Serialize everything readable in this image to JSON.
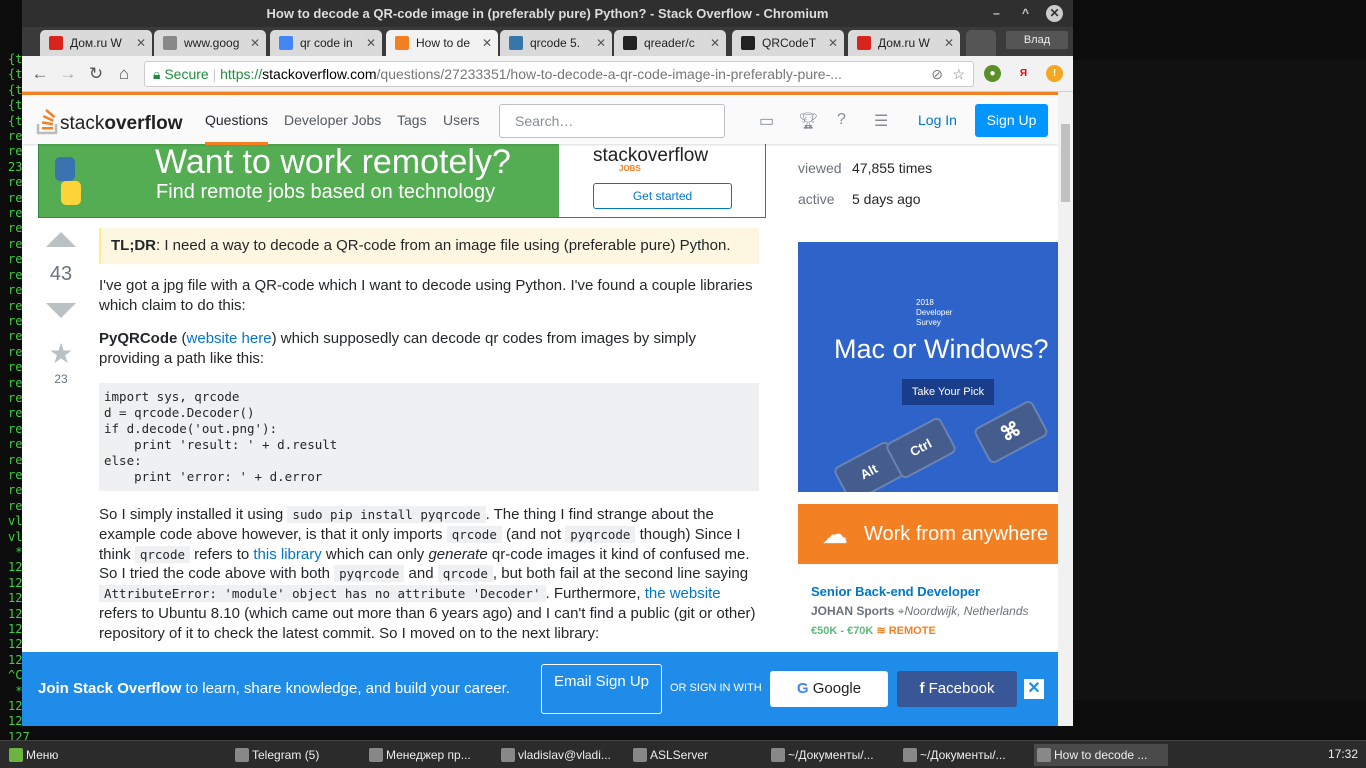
{
  "window": {
    "title": "How to decode a QR-code image in (preferably pure) Python? - Stack Overflow - Chromium"
  },
  "tabs": [
    {
      "label": "Дом.ru W",
      "color": "#d9241e"
    },
    {
      "label": "www.goog",
      "color": "#888888"
    },
    {
      "label": "qr code in",
      "color": "#4285f4"
    },
    {
      "label": "How to de",
      "color": "#f48024"
    },
    {
      "label": "qrcode 5.",
      "color": "#3776ab"
    },
    {
      "label": "qreader/c",
      "color": "#222222"
    },
    {
      "label": "QRCodeT",
      "color": "#222222"
    },
    {
      "label": "Дом.ru W",
      "color": "#d9241e"
    }
  ],
  "profile": "Влад",
  "omnibox": {
    "secure": "Secure",
    "scheme": "https://",
    "host": "stackoverflow.com",
    "path": "/questions/27233351/how-to-decode-a-qr-code-image-in-preferably-pure-..."
  },
  "so": {
    "logo_a": "stack",
    "logo_b": "overflow",
    "nav": [
      "Questions",
      "Developer Jobs",
      "Tags",
      "Users"
    ],
    "search_placeholder": "Search…",
    "login": "Log In",
    "signup": "Sign Up"
  },
  "banner": {
    "headline": "Want to work remotely?",
    "sub": "Find remote jobs based on technology",
    "brand": "stackoverflow",
    "brand_sub": "JOBS",
    "cta": "Get started"
  },
  "question": {
    "votes": "43",
    "favorites": "23",
    "tldr_label": "TL;DR",
    "tldr": ": I need a way to decode a QR-code from an image file using (preferable pure) Python.",
    "p1": "I've got a jpg file with a QR-code which I want to decode using Python. I've found a couple libraries which claim to do this:",
    "p2_b": "PyQRCode",
    "p2_link": "website here",
    "p2_rest": ") which supposedly can decode qr codes from images by simply providing a path like this:",
    "code": "import sys, qrcode\nd = qrcode.Decoder()\nif d.decode('out.png'):\n    print 'result: ' + d.result\nelse:\n    print 'error: ' + d.error",
    "p3": {
      "a": "So I simply installed it using ",
      "c1": "sudo pip install pyqrcode",
      "b": ". The thing I find strange about the example code above however, is that it only imports ",
      "c2": "qrcode",
      "c": " (and not ",
      "c3": "pyqrcode",
      "d": " though) Since I think ",
      "c4": "qrcode",
      "e": " refers to ",
      "l1": "this library",
      "f": " which can only ",
      "em": "generate",
      "g": " qr-code images it kind of confused me. So I tried the code above with both ",
      "c5": "pyqrcode",
      "h": " and ",
      "c6": "qrcode",
      "i": ", but both fail at the second line saying ",
      "c7": "AttributeError: 'module' object has no attribute 'Decoder'",
      "j": ". Furthermore, ",
      "l2": "the website",
      "k": " refers to Ubuntu 8.10 (which came out more than 6 years ago) and I can't find a public (git or other) repository of it to check the latest commit. So I moved on to the next library:"
    }
  },
  "sidebar": {
    "viewed_k": "viewed",
    "viewed_v": "47,855 times",
    "active_k": "active",
    "active_v": "5 days ago",
    "ad": {
      "survey": "2018\nDeveloper\nSurvey",
      "headline": "Mac or Windows?",
      "cta": "Take Your Pick",
      "keys": [
        "Alt",
        "Ctrl",
        "⌘"
      ]
    },
    "wfa": "Work from anywhere",
    "job": {
      "title": "Senior Back-end Developer",
      "company": "JOHAN Sports",
      "location": "Noordwijk, Netherlands",
      "salary": "€50K - €70K",
      "remote": "REMOTE"
    }
  },
  "join": {
    "bold": "Join Stack Overflow",
    "text": " to learn, share knowledge, and build your career.",
    "email": "Email Sign Up",
    "or": "OR SIGN IN WITH",
    "google": "Google",
    "facebook": "Facebook"
  },
  "taskbar": {
    "menu": "Меню",
    "items": [
      "Telegram (5)",
      "Менеджер пр...",
      "vladislav@vladi...",
      "ASLServer",
      "~/Документы/...",
      "~/Документы/...",
      "How to decode ..."
    ],
    "clock": "17:32"
  },
  "terminal": {
    "lines": [
      "{t",
      "{t",
      "{t",
      "{t",
      "{t",
      "re",
      "re",
      "23",
      "re",
      "re",
      "re",
      "re",
      "re",
      "re",
      "re",
      "re",
      "re",
      "re",
      "re",
      "re",
      "re",
      "re",
      "re",
      "re",
      "re",
      "re",
      "re",
      "re",
      "re",
      "re",
      "vla",
      "vla",
      " *",
      "127",
      "127",
      "127",
      "127",
      "127",
      "127",
      "127",
      "^C",
      " *",
      "127",
      "127",
      "127"
    ]
  }
}
